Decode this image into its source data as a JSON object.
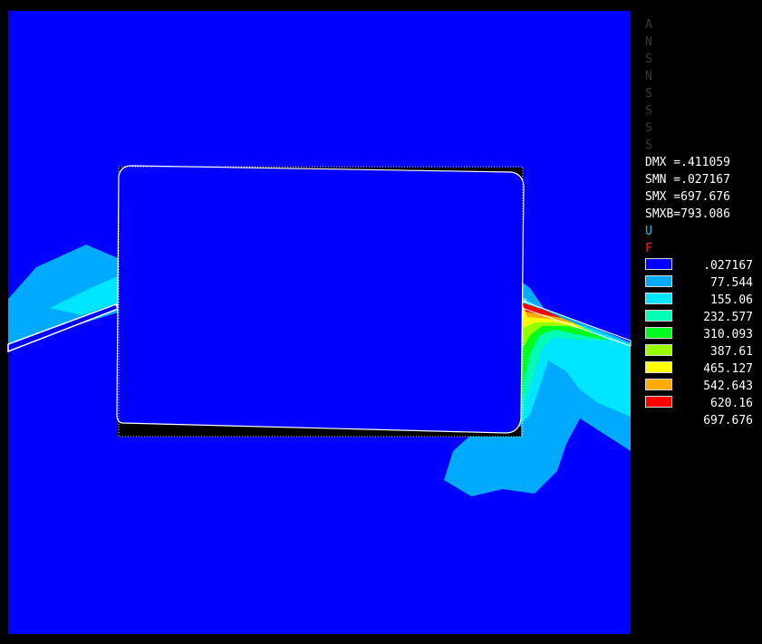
{
  "colors": {
    "background": "#0000ff",
    "frame": "#000000",
    "outline": "#ffffff",
    "symbol_u": "#00c8ff",
    "symbol_f": "#ff2020"
  },
  "legend_info": {
    "hidden_lines": [
      "A",
      "N",
      "S",
      "N",
      "S",
      "S",
      "S",
      "S"
    ],
    "dmx": "DMX =.411059",
    "smn": "SMN =.027167",
    "smx": "SMX =697.676",
    "smxb": "SMXB=793.086",
    "u_label": "U",
    "f_label": "F"
  },
  "contour_legend": [
    {
      "value": ".027167",
      "color": "#0000ff"
    },
    {
      "value": "77.544",
      "color": "#00aaff"
    },
    {
      "value": "155.06",
      "color": "#00e6ff"
    },
    {
      "value": "232.577",
      "color": "#00ffb4"
    },
    {
      "value": "310.093",
      "color": "#00ff1e"
    },
    {
      "value": "387.61",
      "color": "#96ff00"
    },
    {
      "value": "465.127",
      "color": "#ffff00"
    },
    {
      "value": "542.643",
      "color": "#ffaa00"
    },
    {
      "value": "620.16",
      "color": "#ff0000"
    },
    {
      "value": "697.676",
      "color": null
    }
  ]
}
